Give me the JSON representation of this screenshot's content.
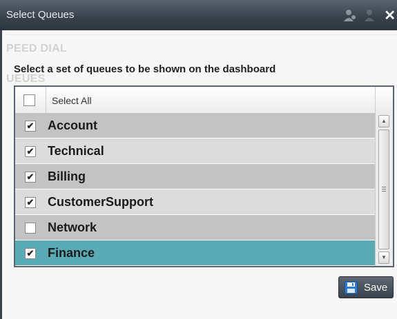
{
  "window": {
    "title": "Select Queues"
  },
  "background": {
    "ghost_speed_dial": "PEED DIAL",
    "ghost_queues": "UEUES"
  },
  "dialog": {
    "instruction": "Select a set of queues to be shown on the dashboard",
    "select_all_label": "Select All",
    "select_all_checked": false,
    "queues": [
      {
        "label": "Account",
        "checked": true,
        "selected": false
      },
      {
        "label": "Technical",
        "checked": true,
        "selected": false
      },
      {
        "label": "Billing",
        "checked": true,
        "selected": false
      },
      {
        "label": "CustomerSupport",
        "checked": true,
        "selected": false
      },
      {
        "label": "Network",
        "checked": false,
        "selected": false
      },
      {
        "label": "Finance",
        "checked": true,
        "selected": true
      }
    ],
    "save_label": "Save"
  },
  "icons": {
    "agent": "person-icon",
    "close": "close-icon",
    "save": "floppy-disk-icon",
    "checkmark": "✔"
  },
  "colors": {
    "titlebar": "#3a434d",
    "row_dark": "#c3c3c3",
    "row_light": "#dcdcdc",
    "row_selected": "#5aaab6",
    "save_icon": "#2f7dd0"
  }
}
